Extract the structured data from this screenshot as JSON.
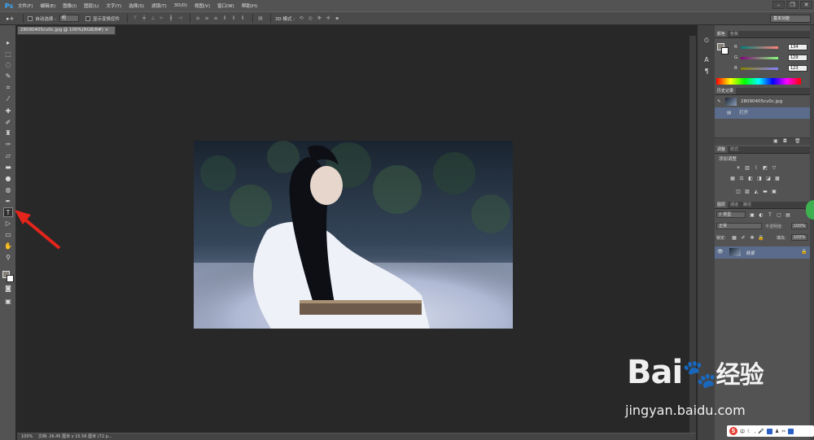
{
  "app": {
    "logo": "Ps"
  },
  "menu": [
    "文件(F)",
    "编辑(E)",
    "图像(I)",
    "图层(L)",
    "文字(Y)",
    "选择(S)",
    "滤镜(T)",
    "3D(D)",
    "视图(V)",
    "窗口(W)",
    "帮助(H)"
  ],
  "options": {
    "auto_select_label": "自动选择 :",
    "auto_select_value": "组",
    "show_transform_label": "显示变换控件",
    "mode_3d_label": "3D 模式 :",
    "workspace": "基本功能"
  },
  "document": {
    "tab_title": "28090405cv0c.jpg @ 100%(RGB/8#)",
    "zoom": "100%",
    "doc_info": "文档: 26.45 厘米 x 15.56 厘米 (72 p..."
  },
  "color_panel": {
    "tabs": [
      "颜色",
      "色板"
    ],
    "r_label": "R",
    "r_value": "134",
    "g_label": "G",
    "g_value": "129",
    "b_label": "B",
    "b_value": "123",
    "fg_color": "#868179"
  },
  "history_panel": {
    "title": "历史记录",
    "snapshot": "28090405cv0c.jpg",
    "step": "打开"
  },
  "adjust_panel": {
    "tabs": [
      "调整",
      "样式"
    ],
    "subtitle": "添加调整"
  },
  "layers_panel": {
    "tabs": [
      "图层",
      "通道",
      "路径"
    ],
    "filter": "类型",
    "blend": "正常",
    "opacity_label": "不透明度:",
    "opacity": "100%",
    "lock_label": "锁定:",
    "fill_label": "填充:",
    "fill": "100%",
    "layer_name": "背景"
  },
  "watermark": {
    "brand": "Bai",
    "brand2": "经验",
    "url": "jingyan.baidu.com"
  },
  "ime": {
    "mode": "中"
  },
  "colors": {
    "accent": "#3da8f5",
    "selection": "#5a6b8b",
    "arrow": "#e5241b"
  }
}
